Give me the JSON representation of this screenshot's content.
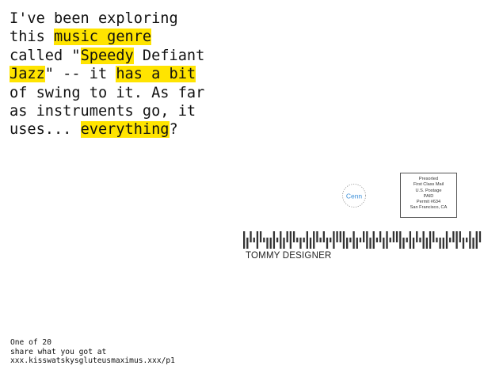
{
  "message": {
    "lines": [
      [
        {
          "t": "I've been exploring",
          "hl": false
        }
      ],
      [
        {
          "t": "this ",
          "hl": false
        },
        {
          "t": "music genre",
          "hl": true
        }
      ],
      [
        {
          "t": "called \"",
          "hl": false
        },
        {
          "t": "Speedy",
          "hl": true
        },
        {
          "t": " Defiant",
          "hl": false
        }
      ],
      [
        {
          "t": "Jazz",
          "hl": true
        },
        {
          "t": "\" -- it ",
          "hl": false
        },
        {
          "t": "has a bit",
          "hl": true
        }
      ],
      [
        {
          "t": "of swing to it. As far",
          "hl": false
        }
      ],
      [
        {
          "t": "as instruments go, it",
          "hl": false
        }
      ],
      [
        {
          "t": "uses... ",
          "hl": false
        },
        {
          "t": "everything",
          "hl": true
        },
        {
          "t": "?",
          "hl": false
        }
      ]
    ]
  },
  "logo": {
    "text": "Cenn"
  },
  "postage": {
    "lines": [
      "Presorted",
      "First Class Mail",
      "U.S. Postage",
      "PAID",
      "Permit #634",
      "San Francisco, CA"
    ]
  },
  "barcode": {
    "bars": "FDATFATDDFTFDAFATDTFDFATADTFAAFDTFDTAFDFTADFTAAFDTFDATFDFATDDFTAFADTFDFA"
  },
  "address": {
    "name": "TOMMY DESIGNER"
  },
  "footer": {
    "line1": "One of 20",
    "line2": "share what you got at",
    "line3": "xxx.kisswatskysgluteusmaximus.xxx/p1"
  },
  "colors": {
    "highlight": "#ffe400",
    "text": "#111111",
    "logo": "#3b8fd9"
  }
}
